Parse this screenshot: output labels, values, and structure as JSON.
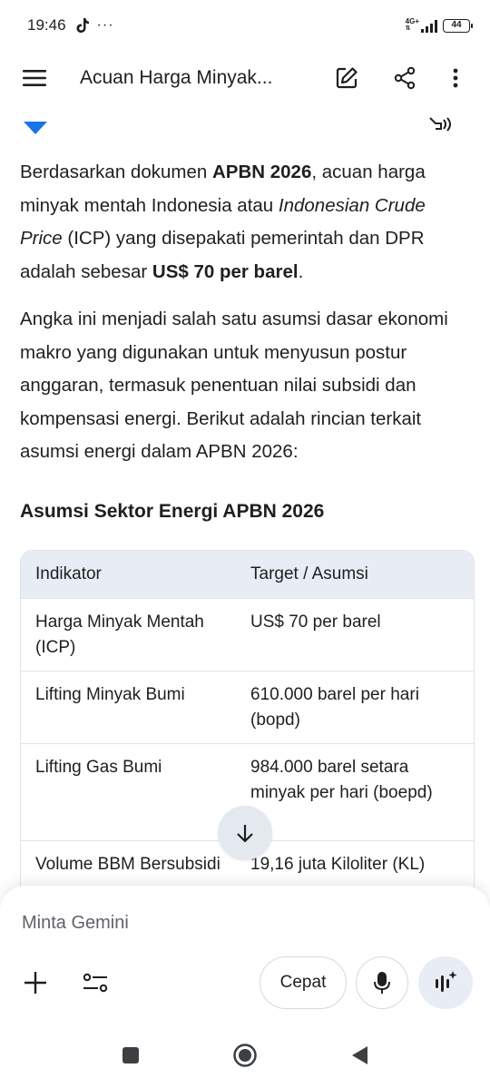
{
  "status": {
    "time": "19:46",
    "extra": "···",
    "network": "4G+",
    "battery": "44"
  },
  "appbar": {
    "title": "Acuan Harga Minyak..."
  },
  "content": {
    "para1": {
      "t1": "Berdasarkan dokumen ",
      "b1": "APBN 2026",
      "t2": ", acuan harga minyak mentah Indonesia atau ",
      "i1": "Indonesian Crude Price",
      "t3": " (ICP) yang disepakati pemerintah dan DPR adalah sebesar ",
      "b2": "US$ 70 per barel",
      "t4": "."
    },
    "para2": "Angka ini menjadi salah satu asumsi dasar ekonomi makro yang digunakan untuk menyusun postur anggaran, termasuk penentuan nilai subsidi dan kompensasi energi. Berikut adalah rincian terkait asumsi energi dalam APBN 2026:",
    "section_title": "Asumsi Sektor Energi APBN 2026",
    "table": {
      "headers": [
        "Indikator",
        "Target / Asumsi"
      ],
      "rows": [
        [
          "Harga Minyak Mentah (ICP)",
          "US$ 70 per barel"
        ],
        [
          "Lifting Minyak Bumi",
          "610.000 barel per hari (bopd)"
        ],
        [
          "Lifting Gas Bumi",
          "984.000 barel setara minyak per hari (boepd)"
        ],
        [
          "Volume BBM Bersubsidi",
          "19,16 juta Kiloliter (KL)"
        ]
      ]
    }
  },
  "composer": {
    "placeholder": "Minta Gemini",
    "mode_label": "Cepat"
  },
  "colors": {
    "accent_blue": "#1a73e8",
    "table_header_bg": "#e8edf5",
    "border": "#dfe3e8"
  }
}
